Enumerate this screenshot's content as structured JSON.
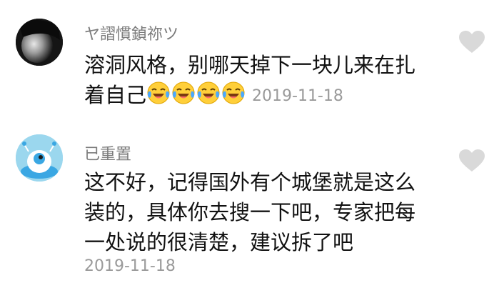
{
  "comments": [
    {
      "username": "ヤ謵慣鍞祢ツ",
      "lines": [
        "溶洞风格，别哪天掉下一块儿来在扎",
        "着自己"
      ],
      "emoji": [
        "laughing-crying-emoji",
        "laughing-crying-emoji",
        "laughing-crying-emoji",
        "laughing-crying-emoji"
      ],
      "date": "2019-11-18",
      "like_icon": "heart-icon"
    },
    {
      "username": "已重置",
      "lines": [
        "这不好，记得国外有个城堡就是这么",
        "装的，具体你去搜一下吧，专家把每",
        "一处说的很清楚，建议拆了吧"
      ],
      "date": "2019-11-18",
      "like_icon": "heart-icon"
    }
  ],
  "colors": {
    "username": "#7b7b7b",
    "text": "#111111",
    "date": "#9a9a9a",
    "heart": "#d9d9d9",
    "avatar2_bg": "#9bd7ee"
  }
}
